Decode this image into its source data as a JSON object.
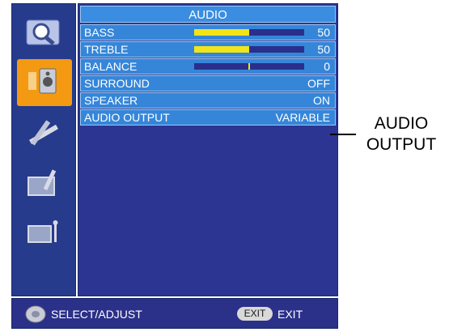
{
  "menu": {
    "title": "AUDIO",
    "rows": [
      {
        "label": "BASS",
        "value": "50",
        "level": 0.5
      },
      {
        "label": "TREBLE",
        "value": "50",
        "level": 0.5
      },
      {
        "label": "BALANCE",
        "value": "0",
        "level": 0.5
      },
      {
        "label": "SURROUND",
        "value": "OFF"
      },
      {
        "label": "SPEAKER",
        "value": "ON"
      },
      {
        "label": "AUDIO OUTPUT",
        "value": "VARIABLE"
      }
    ]
  },
  "sidebar": {
    "items": [
      {
        "icon": "picture-icon"
      },
      {
        "icon": "audio-icon",
        "active": true
      },
      {
        "icon": "setup-tools-icon"
      },
      {
        "icon": "screen-icon"
      },
      {
        "icon": "input-icon"
      }
    ]
  },
  "footer": {
    "hint": "SELECT/ADJUST",
    "exit_button": "EXIT",
    "exit_label": "EXIT"
  },
  "callout": {
    "line1": "AUDIO",
    "line2": "OUTPUT"
  },
  "colors": {
    "panel": "#2d3592",
    "row": "#3586d9",
    "active_icon_bg": "#f39a12",
    "bar_fill": "#f2e418"
  }
}
